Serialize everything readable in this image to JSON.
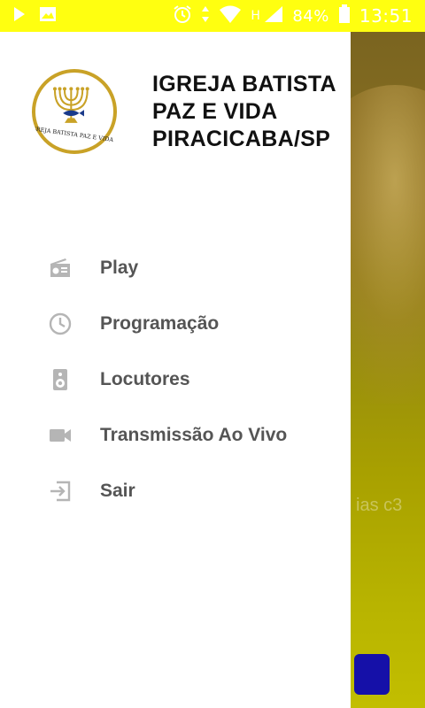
{
  "status_bar": {
    "battery": "84%",
    "time": "13:51",
    "network": "H",
    "icons": [
      "play-icon",
      "image-icon",
      "alarm-icon",
      "data-arrows-icon",
      "wifi-icon",
      "signal-icon",
      "battery-icon"
    ]
  },
  "drawer": {
    "logo": "church-logo-menorah",
    "title_lines": [
      "IGREJA BATISTA",
      "PAZ E VIDA",
      "PIRACICABA/SP"
    ],
    "menu": [
      {
        "label": "Play",
        "icon": "radio-icon"
      },
      {
        "label": "Programação",
        "icon": "clock-icon"
      },
      {
        "label": "Locutores",
        "icon": "speaker-icon"
      },
      {
        "label": "Transmissão Ao Vivo",
        "icon": "videocam-icon"
      },
      {
        "label": "Sair",
        "icon": "exit-icon"
      }
    ]
  },
  "background": {
    "caption": "ias c3"
  },
  "colors": {
    "status_bar": "#ffff10",
    "menu_text": "#555555",
    "menu_icon": "#b5b5b5",
    "title_text": "#111111",
    "logo_ring": "#c9a227"
  }
}
